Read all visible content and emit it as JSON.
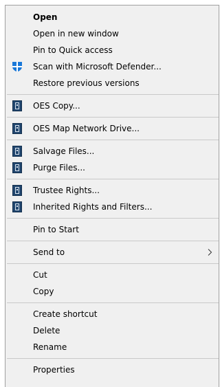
{
  "menu": {
    "open": "Open",
    "open_new_window": "Open in new window",
    "pin_quick_access": "Pin to Quick access",
    "scan_defender": "Scan with Microsoft Defender...",
    "restore_versions": "Restore previous versions",
    "oes_copy": "OES Copy...",
    "oes_map_drive": "OES Map Network Drive...",
    "salvage_files": "Salvage Files...",
    "purge_files": "Purge Files...",
    "trustee_rights": "Trustee Rights...",
    "inherited_rights": "Inherited Rights and Filters...",
    "pin_start": "Pin to Start",
    "send_to": "Send to",
    "cut": "Cut",
    "copy": "Copy",
    "create_shortcut": "Create shortcut",
    "delete": "Delete",
    "rename": "Rename",
    "properties": "Properties"
  },
  "icons": {
    "defender": "defender-shield-icon",
    "oes": "oes-tool-icon",
    "submenu": "chevron-right-icon"
  },
  "colors": {
    "menu_background": "#f0f0f0",
    "separator": "#c9c9c9",
    "defender_blue": "#1a78d8",
    "oes_icon": "#21466e"
  }
}
